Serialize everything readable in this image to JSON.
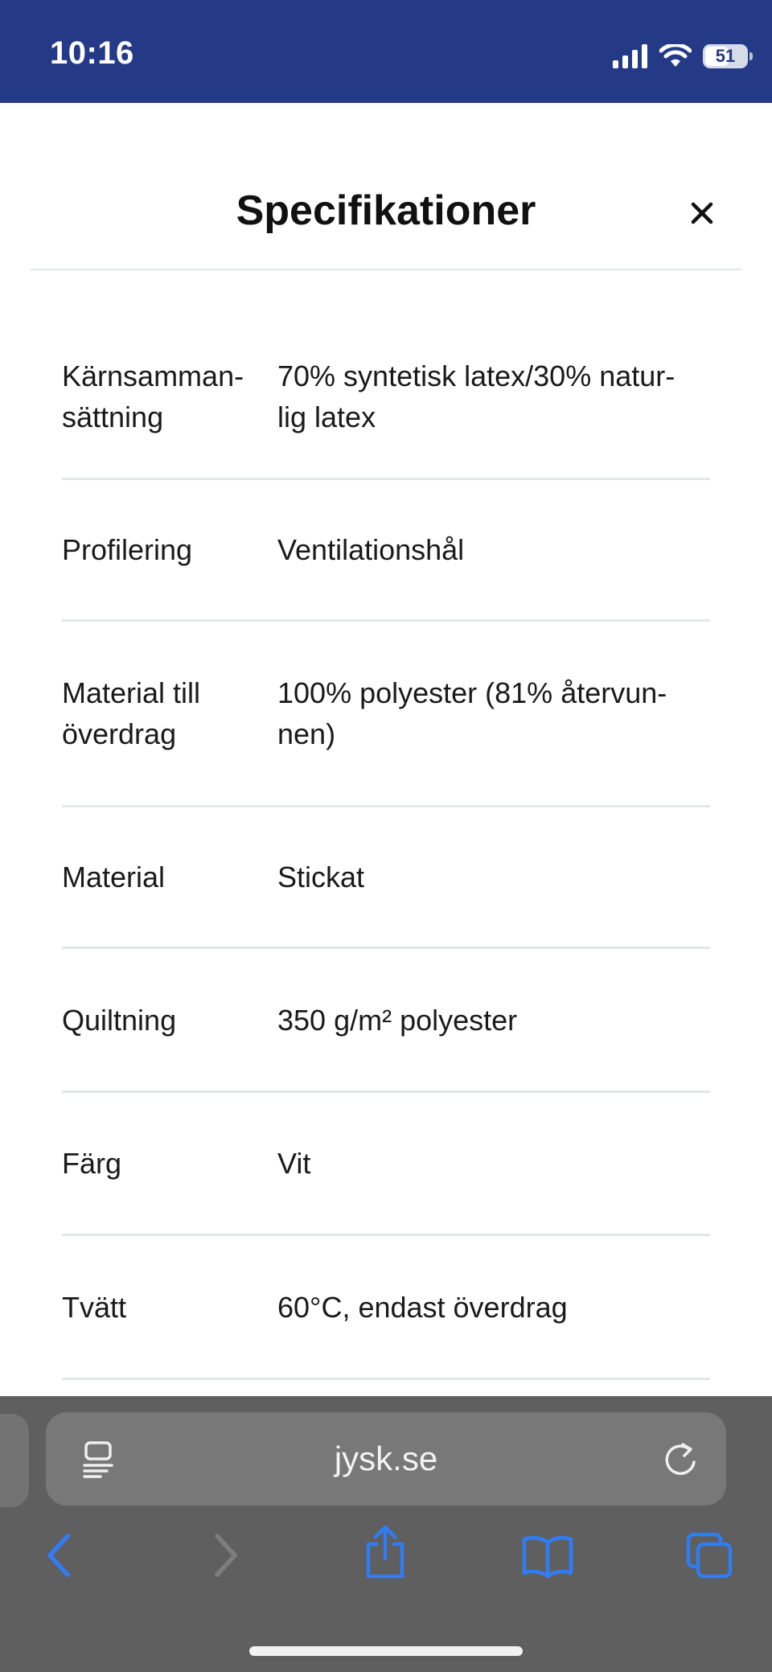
{
  "status_bar": {
    "time": "10:16",
    "battery_level": "51"
  },
  "modal": {
    "title": "Specifikationer",
    "close_icon": "close-icon"
  },
  "specs": [
    {
      "label": [
        "Kärnsamman-",
        "sättning"
      ],
      "value": [
        "70% syntetisk latex/30% natur-",
        "lig latex"
      ]
    },
    {
      "label": [
        "Profilering"
      ],
      "value": [
        "Ventilationshål"
      ]
    },
    {
      "label": [
        "Material till",
        "överdrag"
      ],
      "value": [
        "100% polyester (81% återvun-",
        "nen)"
      ]
    },
    {
      "label": [
        "Material"
      ],
      "value": [
        "Stickat"
      ]
    },
    {
      "label": [
        "Quiltning"
      ],
      "value": [
        "350 g/m² polyester"
      ]
    },
    {
      "label": [
        "Färg"
      ],
      "value": [
        "Vit"
      ]
    },
    {
      "label": [
        "Tvätt"
      ],
      "value": [
        "60°C, endast överdrag"
      ]
    }
  ],
  "browser": {
    "url": "jysk.se",
    "icons": [
      "reader-icon",
      "reload-icon",
      "back-icon",
      "forward-icon",
      "share-icon",
      "bookmarks-icon",
      "tabs-icon"
    ],
    "accent_color": "#2f7df6"
  },
  "colors": {
    "status_bar": "#243a86",
    "toolbar": "#5f5f5f"
  }
}
